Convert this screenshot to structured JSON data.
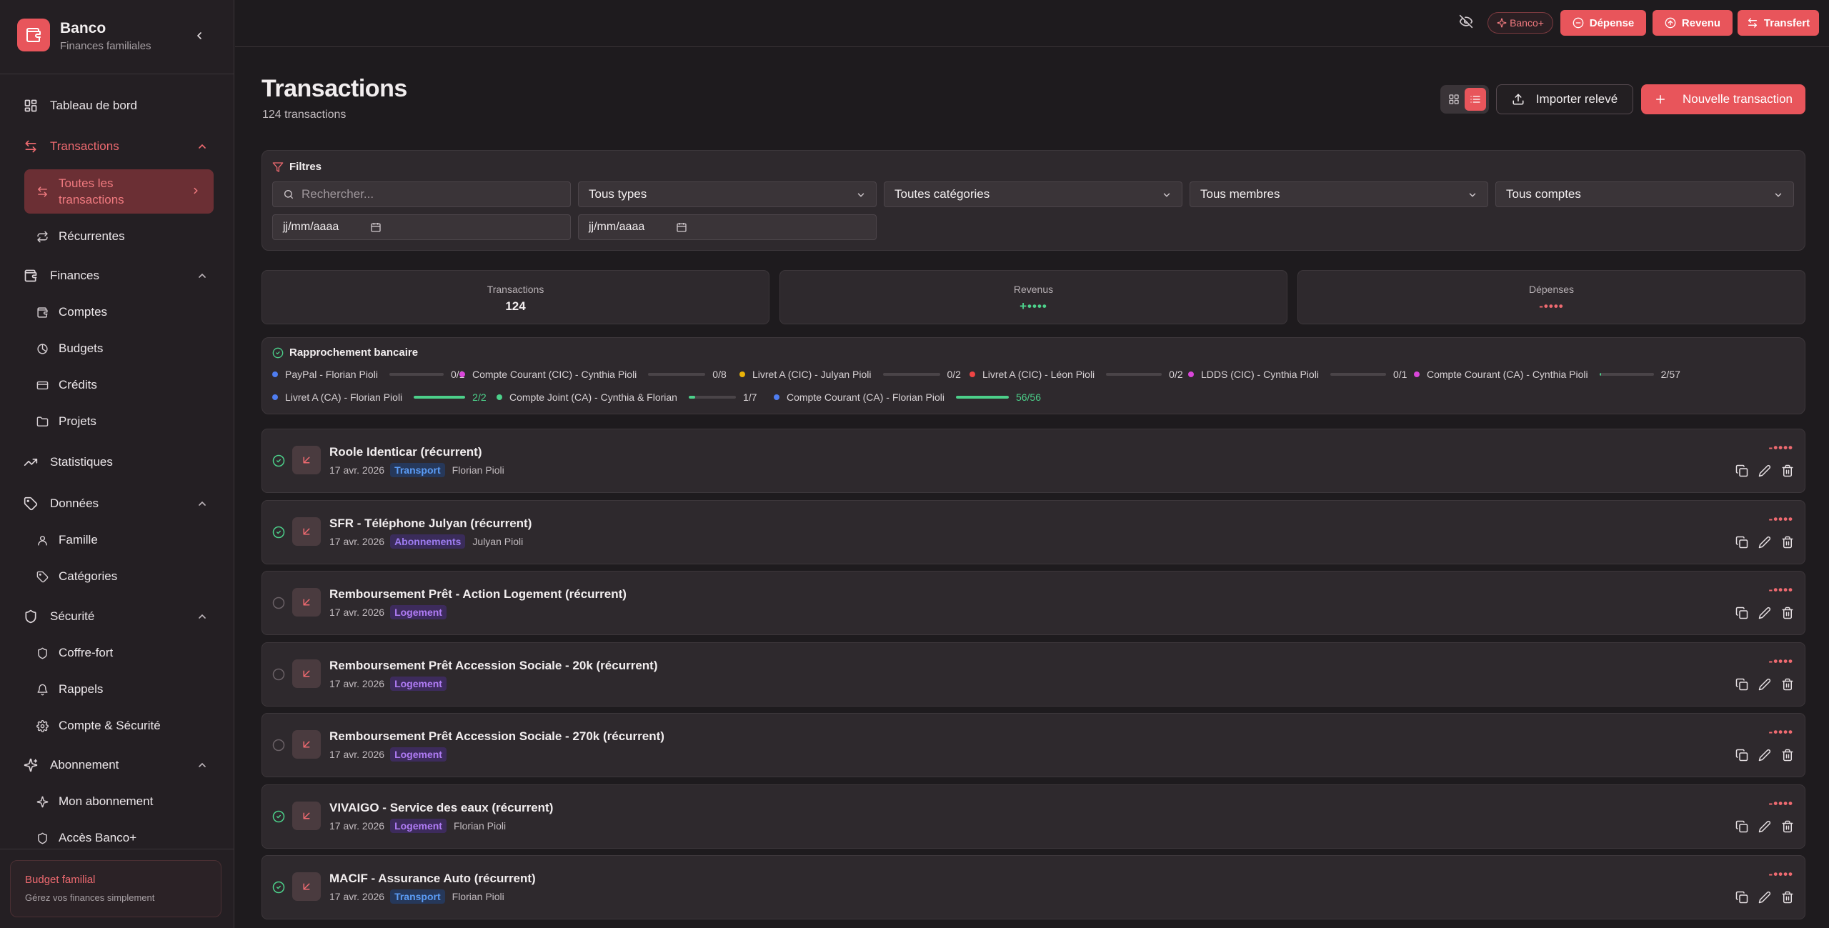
{
  "brand": {
    "name": "Banco",
    "subtitle": "Finances familiales"
  },
  "sidebar": {
    "dashboard": "Tableau de bord",
    "transactions": "Transactions",
    "all_transactions": "Toutes les transactions",
    "recurring": "Récurrentes",
    "finances": "Finances",
    "accounts": "Comptes",
    "budgets": "Budgets",
    "credits": "Crédits",
    "projects": "Projets",
    "stats": "Statistiques",
    "data": "Données",
    "family": "Famille",
    "categories": "Catégories",
    "security": "Sécurité",
    "vault": "Coffre-fort",
    "reminders": "Rappels",
    "account_security": "Compte & Sécurité",
    "subscription": "Abonnement",
    "my_subscription": "Mon abonnement",
    "banco_access": "Accès Banco+",
    "footer_title": "Budget familial",
    "footer_sub": "Gérez vos finances simplement"
  },
  "topbar": {
    "banco_plus": "Banco+",
    "expense": "Dépense",
    "income": "Revenu",
    "transfer": "Transfert"
  },
  "page": {
    "title": "Transactions",
    "count": "124 transactions",
    "import": "Importer relevé",
    "new": "Nouvelle transaction"
  },
  "filters": {
    "title": "Filtres",
    "search_placeholder": "Rechercher...",
    "types": "Tous types",
    "categories": "Toutes catégories",
    "members": "Tous membres",
    "accounts": "Tous comptes",
    "date_from": "jj/mm/aaaa",
    "date_to": "jj/mm/aaaa"
  },
  "stats": [
    {
      "label": "Transactions",
      "value": "124"
    },
    {
      "label": "Revenus",
      "value": "+••••"
    },
    {
      "label": "Dépenses",
      "value": "-••••"
    }
  ],
  "reconciliation": {
    "title": "Rapprochement bancaire",
    "accounts": [
      {
        "name": "PayPal - Florian Pioli",
        "count": "0/1",
        "progress": 0,
        "color": "#4f7df0"
      },
      {
        "name": "Compte Courant (CIC) - Cynthia Pioli",
        "count": "0/8",
        "progress": 0,
        "color": "#d946d9"
      },
      {
        "name": "Livret A (CIC) - Julyan Pioli",
        "count": "0/2",
        "progress": 0,
        "color": "#eab308"
      },
      {
        "name": "Livret A (CIC) - Léon Pioli",
        "count": "0/2",
        "progress": 0,
        "color": "#ef4444"
      },
      {
        "name": "LDDS (CIC) - Cynthia Pioli",
        "count": "0/1",
        "progress": 0,
        "color": "#d946d9"
      },
      {
        "name": "Compte Courant (CA) - Cynthia Pioli",
        "count": "2/57",
        "progress": 0.035,
        "color": "#d946d9"
      },
      {
        "name": "Livret A (CA) - Florian Pioli",
        "count": "2/2",
        "progress": 1,
        "color": "#4f7df0"
      },
      {
        "name": "Compte Joint (CA) - Cynthia & Florian",
        "count": "1/7",
        "progress": 0.14,
        "color": "#4cd08a"
      },
      {
        "name": "Compte Courant (CA) - Florian Pioli",
        "count": "56/56",
        "progress": 1,
        "color": "#4f7df0"
      }
    ]
  },
  "transactions": [
    {
      "name": "Roole Identicar (récurrent)",
      "date": "17 avr. 2026",
      "tag": "Transport",
      "member": "Florian Pioli",
      "amount": "-••••",
      "reconciled": true
    },
    {
      "name": "SFR - Téléphone Julyan (récurrent)",
      "date": "17 avr. 2026",
      "tag": "Abonnements",
      "member": "Julyan Pioli",
      "amount": "-••••",
      "reconciled": true
    },
    {
      "name": "Remboursement Prêt - Action Logement (récurrent)",
      "date": "17 avr. 2026",
      "tag": "Logement",
      "member": "",
      "amount": "-••••",
      "reconciled": false
    },
    {
      "name": "Remboursement Prêt Accession Sociale - 20k (récurrent)",
      "date": "17 avr. 2026",
      "tag": "Logement",
      "member": "",
      "amount": "-••••",
      "reconciled": false
    },
    {
      "name": "Remboursement Prêt Accession Sociale - 270k (récurrent)",
      "date": "17 avr. 2026",
      "tag": "Logement",
      "member": "",
      "amount": "-••••",
      "reconciled": false
    },
    {
      "name": "VIVAIGO - Service des eaux (récurrent)",
      "date": "17 avr. 2026",
      "tag": "Logement",
      "member": "Florian Pioli",
      "amount": "-••••",
      "reconciled": true
    },
    {
      "name": "MACIF - Assurance Auto (récurrent)",
      "date": "17 avr. 2026",
      "tag": "Transport",
      "member": "Florian Pioli",
      "amount": "-••••",
      "reconciled": true
    }
  ]
}
